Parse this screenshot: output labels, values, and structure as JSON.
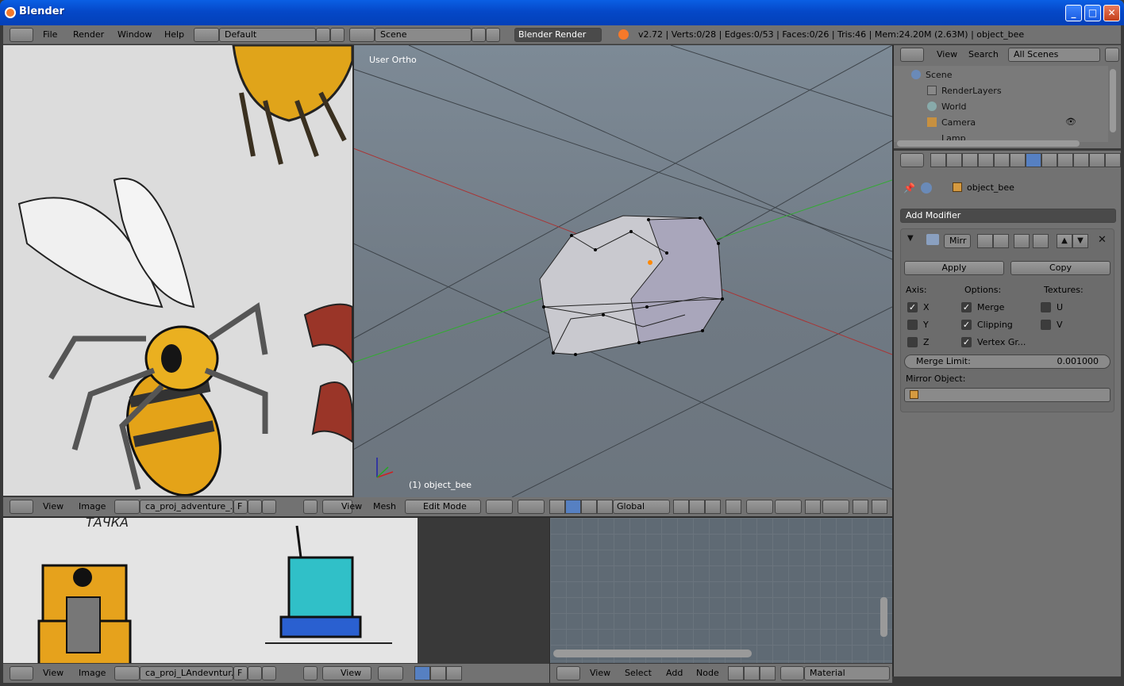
{
  "window": {
    "title": "Blender"
  },
  "info": {
    "menu": [
      "File",
      "Render",
      "Window",
      "Help"
    ],
    "layout": "Default",
    "scene": "Scene",
    "engine": "Blender Render",
    "stats": "v2.72 | Verts:0/28 | Edges:0/53 | Faces:0/26 | Tris:46 | Mem:24.20M (2.63M) | object_bee"
  },
  "viewport": {
    "label": "User Ortho",
    "object_label": "(1) object_bee",
    "menu": [
      "View",
      "Mesh"
    ],
    "mode": "Edit Mode",
    "orientation": "Global"
  },
  "left_image": {
    "menu": [
      "View",
      "Image"
    ],
    "image_name": "ca_proj_adventure_...",
    "fake_user": "F"
  },
  "outliner": {
    "menu": [
      "View",
      "Search"
    ],
    "filter": "All Scenes",
    "items": [
      "Scene",
      "RenderLayers",
      "World",
      "Camera",
      "Lamp"
    ]
  },
  "properties": {
    "object": "object_bee",
    "add_modifier": "Add Modifier",
    "modifier_name": "Mirr",
    "apply": "Apply",
    "copy": "Copy",
    "axis_label": "Axis:",
    "options_label": "Options:",
    "textures_label": "Textures:",
    "axes": [
      {
        "name": "X",
        "checked": true
      },
      {
        "name": "Y",
        "checked": false
      },
      {
        "name": "Z",
        "checked": false
      }
    ],
    "options": [
      {
        "name": "Merge",
        "checked": true
      },
      {
        "name": "Clipping",
        "checked": true
      },
      {
        "name": "Vertex Gr...",
        "checked": true
      }
    ],
    "textures": [
      {
        "name": "U",
        "checked": false
      },
      {
        "name": "V",
        "checked": false
      }
    ],
    "merge_limit_label": "Merge Limit:",
    "merge_limit": "0.001000",
    "mirror_object": "Mirror Object:"
  },
  "bottom_left": {
    "menu": [
      "View",
      "Image"
    ],
    "image_name": "ca_proj_LAndevntur...",
    "fake_user": "F",
    "view": "View",
    "sketch_text": "ТАЧКА"
  },
  "node_editor": {
    "menu": [
      "View",
      "Select",
      "Add",
      "Node"
    ],
    "material": "Material"
  }
}
